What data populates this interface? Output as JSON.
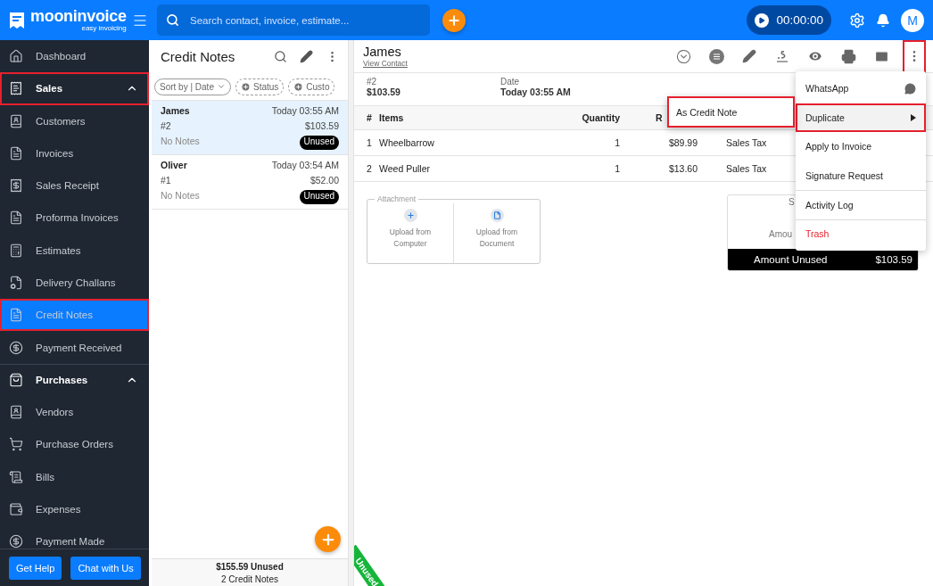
{
  "topbar": {
    "logo": "mooninvoice",
    "tagline": "easy invoicing",
    "search": {
      "placeholder": "Search contact, invoice, estimate..."
    },
    "timer": "00:00:00",
    "avatar": "M"
  },
  "sidebar": {
    "nav": [
      {
        "kind": "link",
        "label": "Dashboard",
        "selected": false,
        "highlighted": false
      },
      {
        "kind": "group",
        "label": "Sales",
        "expanded": true,
        "highlighted": true,
        "children": [
          {
            "label": "Customers",
            "selected": false,
            "highlighted": false
          },
          {
            "label": "Invoices",
            "selected": false,
            "highlighted": false
          },
          {
            "label": "Sales Receipt",
            "selected": false,
            "highlighted": false
          },
          {
            "label": "Proforma Invoices",
            "selected": false,
            "highlighted": false
          },
          {
            "label": "Estimates",
            "selected": false,
            "highlighted": false
          },
          {
            "label": "Delivery Challans",
            "selected": false,
            "highlighted": false
          },
          {
            "label": "Credit Notes",
            "selected": true,
            "highlighted": true
          },
          {
            "label": "Payment Received",
            "selected": false,
            "highlighted": false
          }
        ]
      },
      {
        "kind": "group",
        "label": "Purchases",
        "expanded": true,
        "highlighted": false,
        "children": [
          {
            "label": "Vendors",
            "selected": false,
            "highlighted": false
          },
          {
            "label": "Purchase Orders",
            "selected": false,
            "highlighted": false
          },
          {
            "label": "Bills",
            "selected": false,
            "highlighted": false
          },
          {
            "label": "Expenses",
            "selected": false,
            "highlighted": false
          },
          {
            "label": "Payment Made",
            "selected": false,
            "highlighted": false
          }
        ]
      }
    ],
    "buttons": [
      "Get Help",
      "Chat with Us"
    ]
  },
  "list": {
    "title": "Credit Notes",
    "filters": [
      {
        "kind": "sort",
        "label": "Sort by | Date"
      },
      {
        "kind": "add",
        "label": "Status"
      },
      {
        "kind": "add",
        "label": "Custo"
      }
    ],
    "notes": [
      {
        "name": "James",
        "time": "Today 03:55 AM",
        "number": "#2",
        "amount": "$103.59",
        "notes": "No Notes",
        "status": "Unused",
        "selected": true
      },
      {
        "name": "Oliver",
        "time": "Today 03:54 AM",
        "number": "#1",
        "amount": "$52.00",
        "notes": "No Notes",
        "status": "Unused",
        "selected": false
      }
    ],
    "footer": {
      "total": "$155.59 Unused",
      "count": "2 Credit Notes"
    }
  },
  "detail": {
    "name": "James",
    "link": "View Contact",
    "more_highlighted": true,
    "number": "#2",
    "amount": "$103.59",
    "date_label": "Date",
    "date": "Today 03:55 AM",
    "columns": [
      "#",
      "Items",
      "Quantity",
      "R"
    ],
    "rows": [
      [
        "1",
        "Wheelbarrow",
        "1",
        "$89.99",
        "Sales Tax"
      ],
      [
        "2",
        "Weed Puller",
        "1",
        "$13.60",
        "Sales Tax"
      ]
    ],
    "attachment": {
      "legend": "Attachment",
      "actions": [
        "Upload from Computer",
        "Upload from Document"
      ]
    },
    "summary": {
      "line_1": "S",
      "line_2": "Amou",
      "total_label": "Amount Unused",
      "total": "$103.59"
    },
    "ribbon": "Unused"
  },
  "menu": {
    "items": [
      {
        "kind": "share",
        "label": "WhatsApp",
        "highlighted": false,
        "divider_before": false
      },
      {
        "kind": "submenu",
        "label": "Duplicate",
        "highlighted": true,
        "divider_before": false
      },
      {
        "kind": "plain",
        "label": "Apply to Invoice",
        "highlighted": false,
        "divider_before": false
      },
      {
        "kind": "plain",
        "label": "Signature Request",
        "highlighted": false,
        "divider_before": false
      },
      {
        "kind": "plain",
        "label": "Activity Log",
        "highlighted": false,
        "divider_before": true
      },
      {
        "kind": "danger",
        "label": "Trash",
        "highlighted": false,
        "divider_before": true
      }
    ],
    "submenu": [
      {
        "label": "As Credit Note",
        "highlighted": true
      }
    ]
  }
}
